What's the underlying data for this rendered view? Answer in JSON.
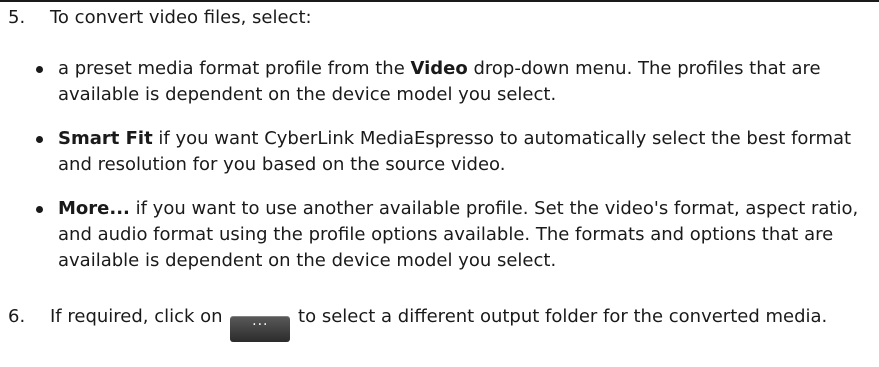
{
  "step5": {
    "number": "5.",
    "text": "To convert video files, select:"
  },
  "bullets": [
    {
      "pre": "a preset media format profile from the ",
      "bold": "Video",
      "post": " drop-down menu. The profiles that are available is dependent on the device model you select."
    },
    {
      "pre": "",
      "bold": "Smart Fit",
      "post": " if you want CyberLink MediaEspresso to automatically select the best format and resolution for you based on the source video."
    },
    {
      "pre": "",
      "bold": "More...",
      "post": " if you want to use another available profile. Set the video's format, aspect ratio, and audio format using the profile options available. The formats and options that are available is dependent on the device model you select."
    }
  ],
  "step6": {
    "number": "6.",
    "pre": "If required, click on ",
    "button_label": "···",
    "post": " to select a different output folder for the converted media."
  }
}
